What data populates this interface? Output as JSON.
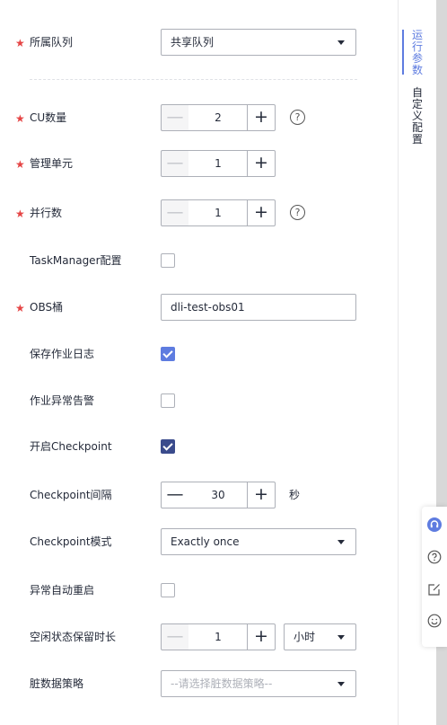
{
  "form": {
    "queue": {
      "label": "所属队列",
      "required": true,
      "value": "共享队列"
    },
    "cu": {
      "label": "CU数量",
      "required": true,
      "value": "2",
      "help": "?"
    },
    "manager_unit": {
      "label": "管理单元",
      "required": true,
      "value": "1"
    },
    "parallelism": {
      "label": "并行数",
      "required": true,
      "value": "1",
      "help": "?"
    },
    "taskmanager": {
      "label": "TaskManager配置",
      "checked": false
    },
    "obs_bucket": {
      "label": "OBS桶",
      "required": true,
      "value": "dli-test-obs01"
    },
    "save_log": {
      "label": "保存作业日志",
      "checked": true
    },
    "alarm": {
      "label": "作业异常告警",
      "checked": false
    },
    "checkpoint": {
      "label": "开启Checkpoint",
      "checked": true
    },
    "checkpoint_interval": {
      "label": "Checkpoint间隔",
      "value": "30",
      "unit": "秒"
    },
    "checkpoint_mode": {
      "label": "Checkpoint模式",
      "value": "Exactly once"
    },
    "auto_restart": {
      "label": "异常自动重启",
      "checked": false
    },
    "idle_time": {
      "label": "空闲状态保留时长",
      "value": "1",
      "unit": "小时"
    },
    "dirty_data": {
      "label": "脏数据策略",
      "placeholder": "--请选择脏数据策略--"
    }
  },
  "stepper": {
    "minus": "—",
    "plus": "+"
  },
  "side_tabs": {
    "active": "运行参数",
    "other": "自定义配置"
  },
  "float_icons": [
    "headset-icon",
    "question-icon",
    "edit-icon",
    "smile-icon"
  ],
  "colors": {
    "accent": "#5e7ce0",
    "required": "#e54545",
    "border": "#adb0b8"
  }
}
